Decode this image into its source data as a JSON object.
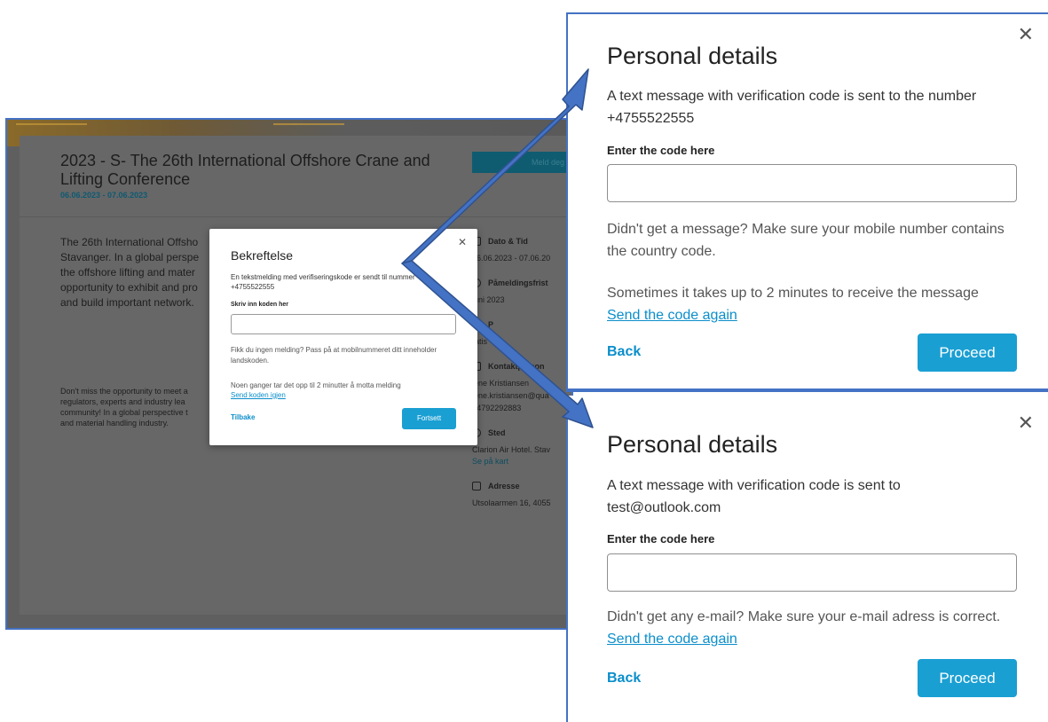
{
  "background_page": {
    "title": "2023 - S- The 26th International Offshore Crane and Lifting Conference",
    "dates": "06.06.2023 - 07.06.2023",
    "signup_label": "Meld deg",
    "intro_lines": [
      "The 26th International Offsho",
      "Stavanger. In a global perspe",
      "the offshore lifting and mater",
      "opportunity to exhibit and pro",
      "and build important network."
    ],
    "body_lines": [
      "Don't miss the opportunity to meet a",
      "regulators, experts and industry lea",
      "community! In a global perspective t",
      "and material handling industry."
    ],
    "sidebar": [
      {
        "label": "Dato & Tid",
        "icon": "calendar-icon",
        "values": [
          "06.06.2023 - 07.06.20"
        ]
      },
      {
        "label": "Påmeldingsfrist",
        "icon": "clock-icon",
        "values": [
          "juni 2023"
        ]
      },
      {
        "label": "P",
        "icon": "price-icon",
        "values": [
          "ratis"
        ]
      },
      {
        "label": "Kontaktperson",
        "icon": "contact-icon",
        "values": [
          "lene Kristiansen",
          "lene.kristiansen@qua",
          "+4792292883"
        ]
      },
      {
        "label": "Sted",
        "icon": "location-icon",
        "values": [
          "Clarion Air Hotel. Stav"
        ],
        "link": "Se på kart"
      },
      {
        "label": "Adresse",
        "icon": "building-icon",
        "values": [
          "Utsolaarmen 16, 4055"
        ]
      }
    ]
  },
  "norwegian_modal": {
    "title": "Bekreftelse",
    "message": "En tekstmelding med verifiseringskode er sendt til nummer +4755522555",
    "code_label": "Skriv inn koden her",
    "code_value": "",
    "hint": "Fikk du ingen melding? Pass på at mobilnummeret ditt inneholder landskoden.",
    "wait_text": "Noen ganger tar det opp til 2 minutter å motta melding",
    "resend_label": "Send koden igjen",
    "back_label": "Tilbake",
    "proceed_label": "Fortsett"
  },
  "sms_modal": {
    "title": "Personal details",
    "message": "A text message with verification code is sent to the number +4755522555",
    "code_label": "Enter the code here",
    "code_value": "",
    "hint": "Didn't get a message? Make sure your mobile number contains the country code.",
    "wait_text": "Sometimes it takes up to 2 minutes to receive the message",
    "resend_label": "Send the code again",
    "back_label": "Back",
    "proceed_label": "Proceed"
  },
  "email_modal": {
    "title": "Personal details",
    "message": "A text message with verification code is sent to test@outlook.com",
    "code_label": "Enter the code here",
    "code_value": "",
    "hint": "Didn't get any e-mail? Make sure your e-mail adress is correct.",
    "resend_label": "Send the code again",
    "back_label": "Back",
    "proceed_label": "Proceed"
  },
  "colors": {
    "accent": "#1a9fd3",
    "link": "#0b8ecb",
    "annotation_border": "#4472c4",
    "arrow_fill": "#4472c4"
  },
  "icons": {
    "close": "close-icon"
  }
}
